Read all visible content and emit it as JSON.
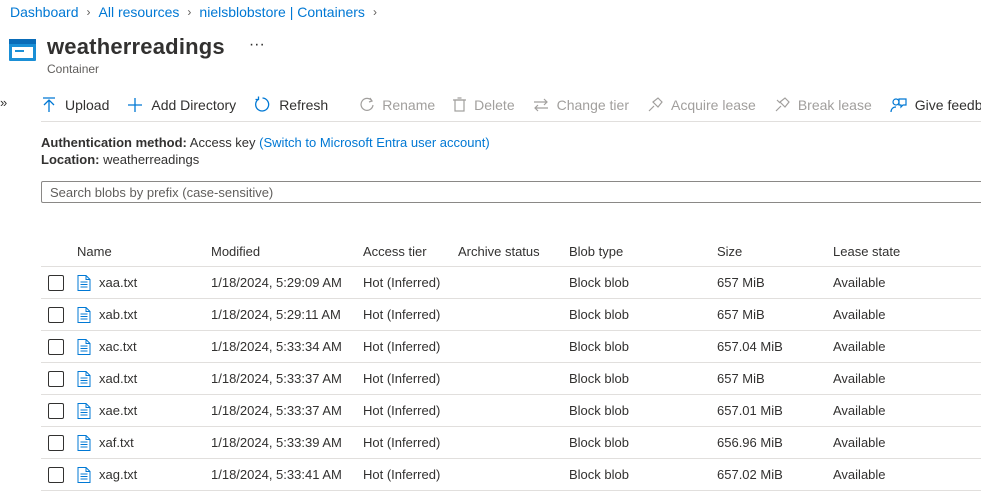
{
  "breadcrumb": [
    "Dashboard",
    "All resources",
    "nielsblobstore | Containers"
  ],
  "page": {
    "title": "weatherreadings",
    "subtitle": "Container",
    "more": "···"
  },
  "toolbar": {
    "upload": "Upload",
    "add_directory": "Add Directory",
    "refresh": "Refresh",
    "rename": "Rename",
    "delete": "Delete",
    "change_tier": "Change tier",
    "acquire_lease": "Acquire lease",
    "break_lease": "Break lease",
    "feedback": "Give feedback"
  },
  "info": {
    "auth_label": "Authentication method:",
    "auth_value": "Access key",
    "auth_link": "(Switch to Microsoft Entra user account)",
    "location_label": "Location:",
    "location_value": "weatherreadings"
  },
  "search": {
    "placeholder": "Search blobs by prefix (case-sensitive)"
  },
  "columns": [
    "Name",
    "Modified",
    "Access tier",
    "Archive status",
    "Blob type",
    "Size",
    "Lease state"
  ],
  "rows": [
    {
      "name": "xaa.txt",
      "modified": "1/18/2024, 5:29:09 AM",
      "tier": "Hot (Inferred)",
      "archive": "",
      "type": "Block blob",
      "size": "657 MiB",
      "lease": "Available"
    },
    {
      "name": "xab.txt",
      "modified": "1/18/2024, 5:29:11 AM",
      "tier": "Hot (Inferred)",
      "archive": "",
      "type": "Block blob",
      "size": "657 MiB",
      "lease": "Available"
    },
    {
      "name": "xac.txt",
      "modified": "1/18/2024, 5:33:34 AM",
      "tier": "Hot (Inferred)",
      "archive": "",
      "type": "Block blob",
      "size": "657.04 MiB",
      "lease": "Available"
    },
    {
      "name": "xad.txt",
      "modified": "1/18/2024, 5:33:37 AM",
      "tier": "Hot (Inferred)",
      "archive": "",
      "type": "Block blob",
      "size": "657 MiB",
      "lease": "Available"
    },
    {
      "name": "xae.txt",
      "modified": "1/18/2024, 5:33:37 AM",
      "tier": "Hot (Inferred)",
      "archive": "",
      "type": "Block blob",
      "size": "657.01 MiB",
      "lease": "Available"
    },
    {
      "name": "xaf.txt",
      "modified": "1/18/2024, 5:33:39 AM",
      "tier": "Hot (Inferred)",
      "archive": "",
      "type": "Block blob",
      "size": "656.96 MiB",
      "lease": "Available"
    },
    {
      "name": "xag.txt",
      "modified": "1/18/2024, 5:33:41 AM",
      "tier": "Hot (Inferred)",
      "archive": "",
      "type": "Block blob",
      "size": "657.02 MiB",
      "lease": "Available"
    }
  ],
  "colors": {
    "accent": "#0078d4",
    "text": "#323130",
    "disabled": "#a19f9d",
    "border": "#e1dfdd"
  }
}
